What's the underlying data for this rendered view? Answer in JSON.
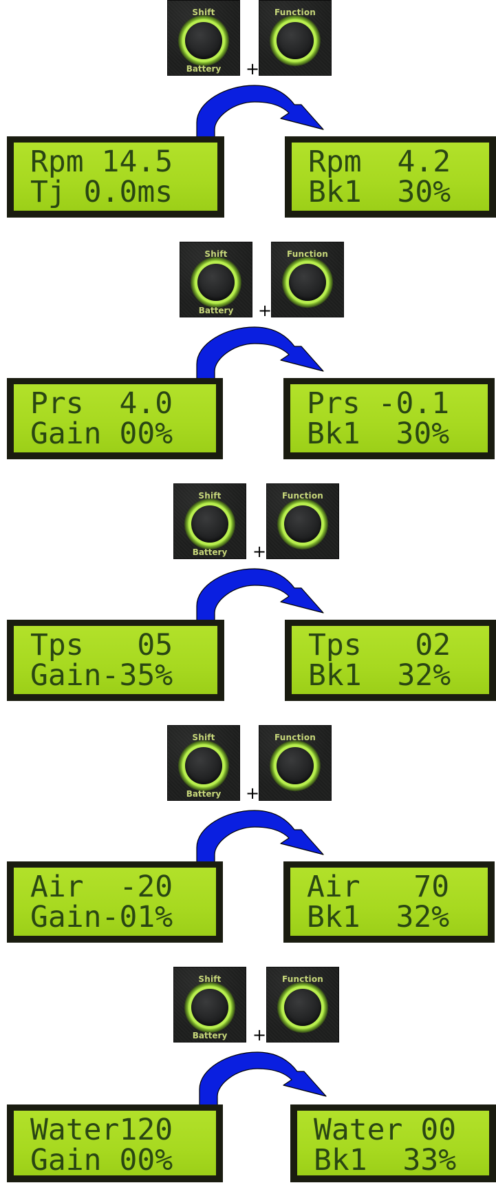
{
  "button_labels": {
    "shift_title": "Shift",
    "shift_sub": "Battery",
    "function_title": "Function"
  },
  "plus_sign": "+",
  "colors": {
    "arrow_fill": "#0a1fe0",
    "lcd_background": "#a9db22",
    "lcd_text": "#1f3a12",
    "button_ring": "#b9ef4f"
  },
  "steps": [
    {
      "before": {
        "line1": "Rpm 14.5",
        "line2": "Tj 0.0ms"
      },
      "after": {
        "line1": "Rpm  4.2",
        "line2": "Bk1  30%"
      }
    },
    {
      "before": {
        "line1": "Prs  4.0",
        "line2": "Gain 00%"
      },
      "after": {
        "line1": "Prs -0.1",
        "line2": "Bk1  30%"
      }
    },
    {
      "before": {
        "line1": "Tps   05",
        "line2": "Gain-35%"
      },
      "after": {
        "line1": "Tps   02",
        "line2": "Bk1  32%"
      }
    },
    {
      "before": {
        "line1": "Air  -20",
        "line2": "Gain-01%"
      },
      "after": {
        "line1": "Air   70",
        "line2": "Bk1  32%"
      }
    },
    {
      "before": {
        "line1": "Water120",
        "line2": "Gain 00%"
      },
      "after": {
        "line1": "Water 00",
        "line2": "Bk1  33%"
      }
    }
  ]
}
